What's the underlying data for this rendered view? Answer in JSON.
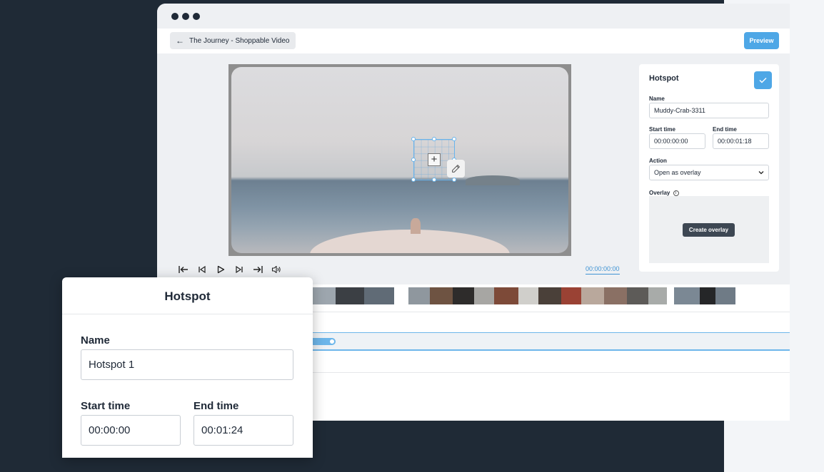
{
  "editor": {
    "back_label": "The Journey - Shoppable Video",
    "preview_label": "Preview",
    "timecode": "00:00:00:00"
  },
  "hotspot_panel": {
    "title": "Hotspot",
    "name_label": "Name",
    "name_value": "Muddy-Crab-3311",
    "start_label": "Start time",
    "start_value": "00:00:00:00",
    "end_label": "End time",
    "end_value": "00:00:01:18",
    "action_label": "Action",
    "action_value": "Open as overlay",
    "overlay_label": "Overlay",
    "create_overlay_label": "Create overlay"
  },
  "hotspot_card": {
    "title": "Hotspot",
    "name_label": "Name",
    "name_value": "Hotspot 1",
    "start_label": "Start time",
    "start_value": "00:00:00",
    "end_label": "End time",
    "end_value": "00:01:24"
  },
  "colors": {
    "accent": "#4ea7e6",
    "background_dark": "#1f2a36",
    "button_dark": "#3d4753"
  }
}
